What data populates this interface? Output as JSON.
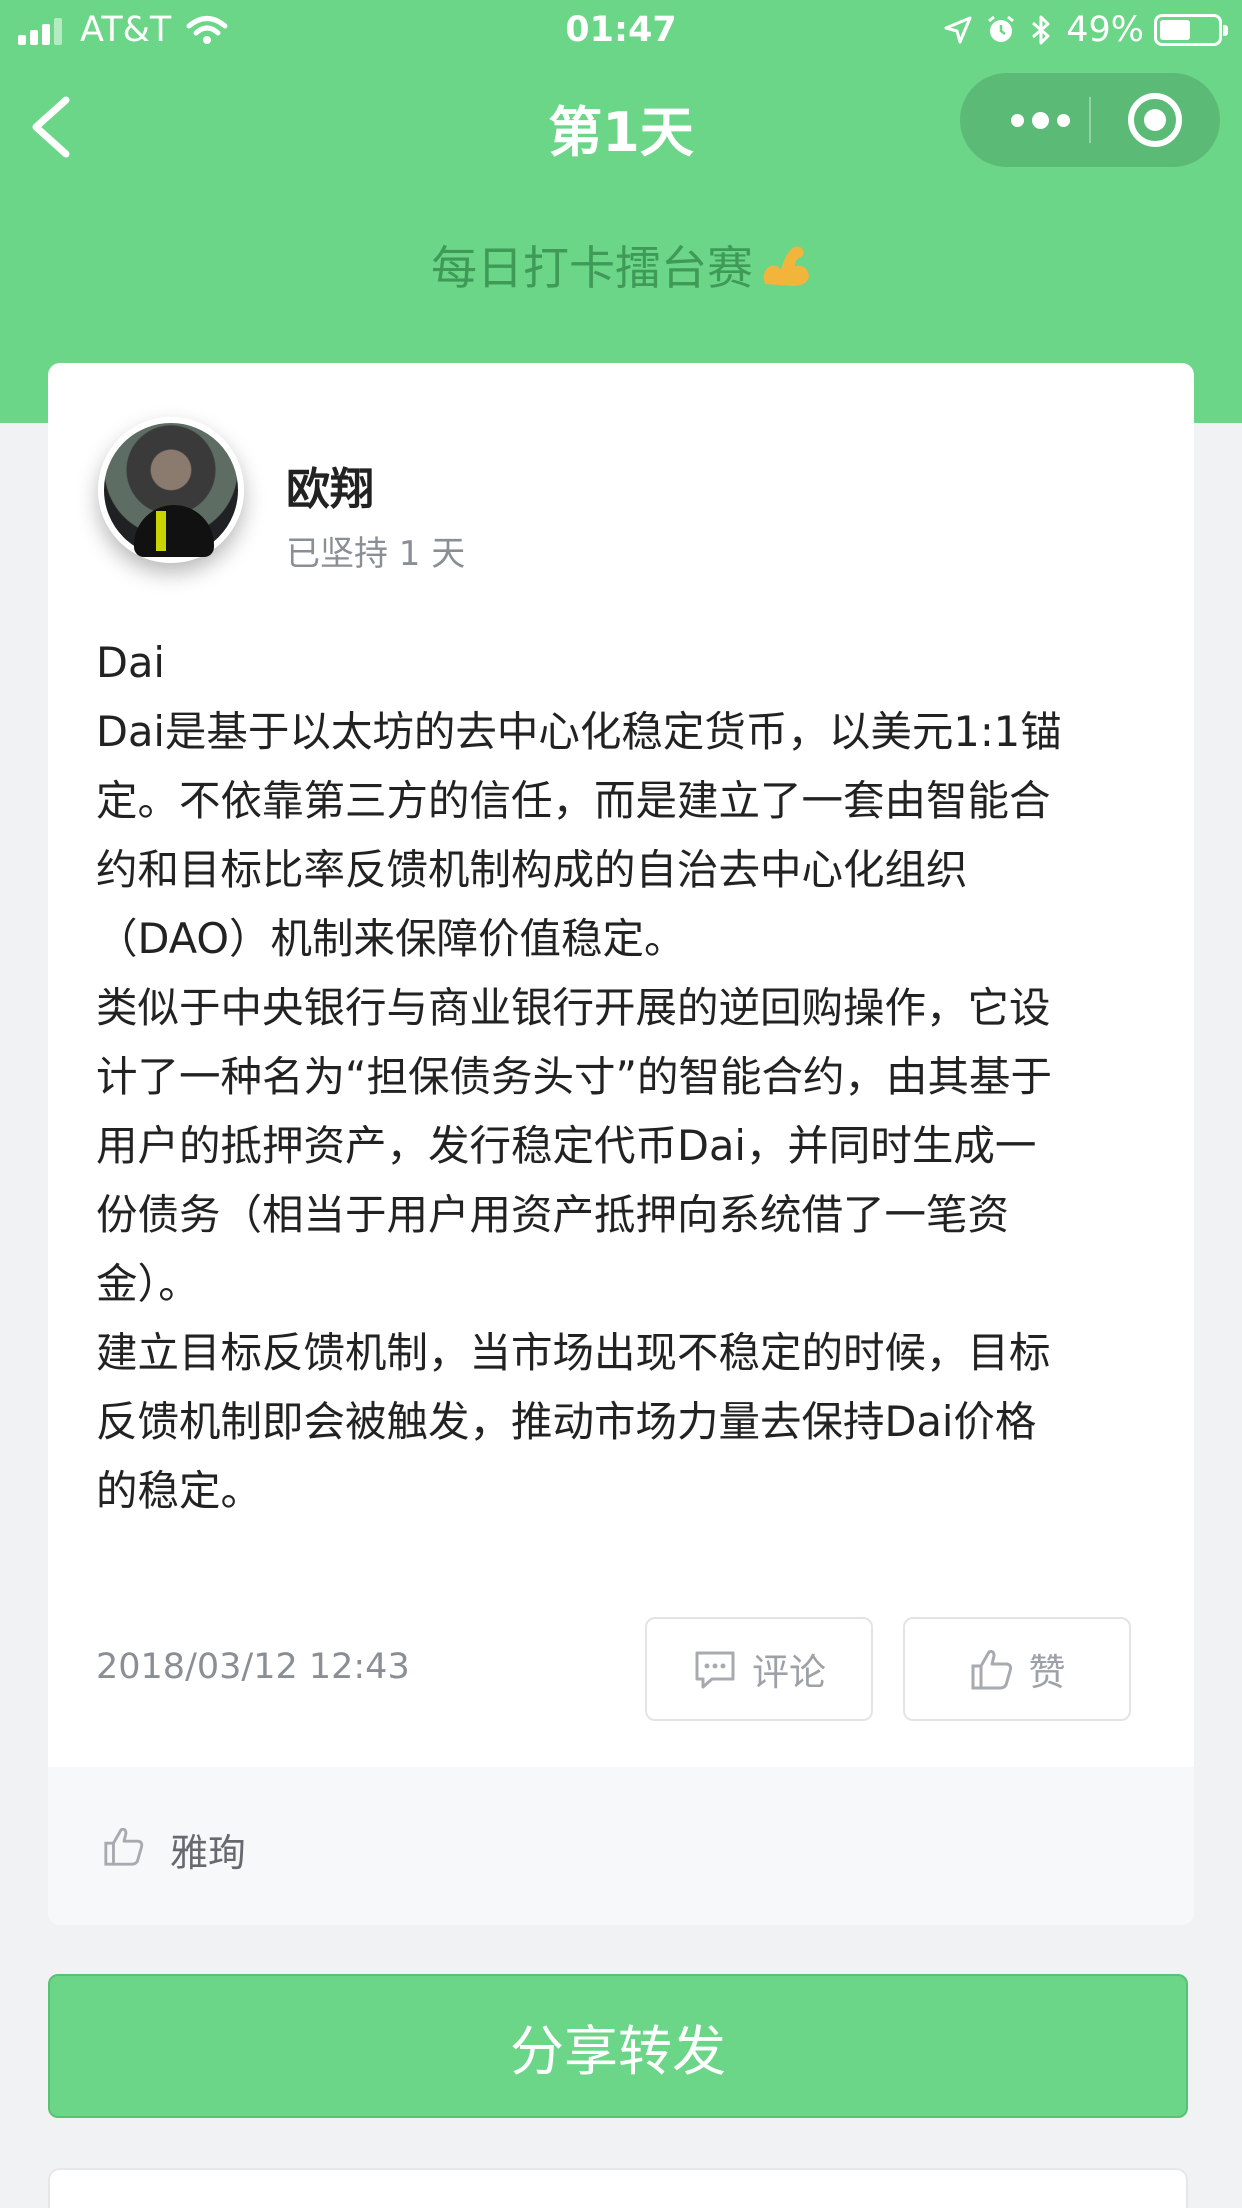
{
  "status_bar": {
    "carrier": "AT&T",
    "time": "01:47",
    "battery": "49%"
  },
  "nav": {
    "title": "第1天"
  },
  "subtitle": "每日打卡擂台赛",
  "post": {
    "author": "欧翔",
    "streak": "已坚持 1 天",
    "lines": [
      "Dai",
      "Dai是基于以太坊的去中心化稳定货币，以美元1:1锚",
      "定。不依靠第三方的信任，而是建立了一套由智能合",
      "约和目标比率反馈机制构成的自治去中心化组织",
      "（DAO）机制来保障价值稳定。",
      "类似于中央银行与商业银行开展的逆回购操作，它设",
      "计了一种名为“担保债务头寸”的智能合约，由其基于",
      "用户的抵押资产，发行稳定代币Dai，并同时生成一",
      "份债务（相当于用户用资产抵押向系统借了一笔资",
      "金）。",
      "建立目标反馈机制，当市场出现不稳定的时候，目标",
      "反馈机制即会被触发，推动市场力量去保持Dai价格",
      "的稳定。"
    ],
    "timestamp": "2018/03/12 12:43",
    "comment_label": "评论",
    "like_label": "赞",
    "likers": "雅珣"
  },
  "share_label": "分享转发",
  "colors": {
    "brand_green": "#6bd687",
    "text_gray": "#8a8f96"
  }
}
